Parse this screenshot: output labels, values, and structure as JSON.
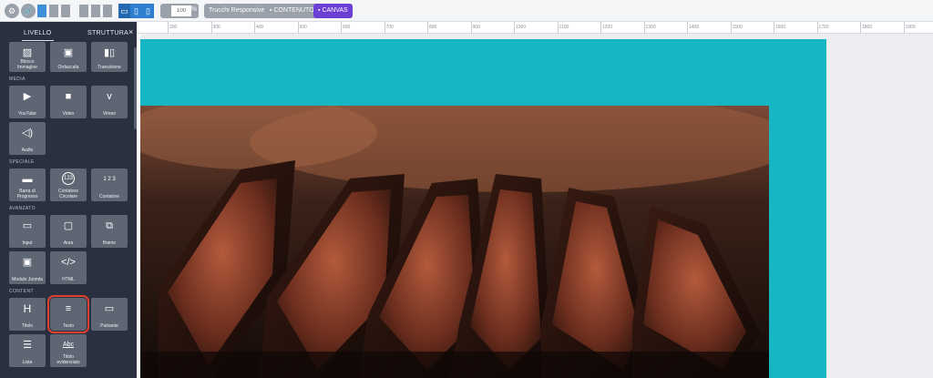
{
  "toolbar": {
    "zoom_value": "100",
    "zoom_unit": "%",
    "responsive_tricks": "Trucchi Responsive",
    "mode_content": "CONTENUTO",
    "mode_canvas": "CANVAS",
    "colors": {
      "grey": "#9aa1ab",
      "blue": "#3d8fd8",
      "purple": "#6b3fd6"
    }
  },
  "sidebar": {
    "tab_layer": "LIVELLO",
    "tab_structure": "STRUTTURA",
    "close_icon": "×",
    "top_row": [
      {
        "icon": "image-block-icon",
        "label": "Blocco Immagine"
      },
      {
        "icon": "image-icon",
        "label": "Ordascafa"
      },
      {
        "icon": "transition-icon",
        "label": "Transizione"
      }
    ],
    "sections": [
      {
        "title": "MEDIA",
        "items": [
          {
            "icon": "youtube-icon",
            "label": "YouTube"
          },
          {
            "icon": "video-camera-icon",
            "label": "Video"
          },
          {
            "icon": "vimeo-icon",
            "label": "Vimeo"
          },
          {
            "icon": "audio-icon",
            "label": "Audio"
          }
        ]
      },
      {
        "title": "SPECIALE",
        "items": [
          {
            "icon": "progress-bar-icon",
            "label": "Barra di Progresso"
          },
          {
            "icon": "circle-counter-icon",
            "label": "Contatore Circolare"
          },
          {
            "icon": "counter-icon",
            "label": "Contatore"
          }
        ]
      },
      {
        "title": "AVANZATO",
        "items": [
          {
            "icon": "input-icon",
            "label": "Input"
          },
          {
            "icon": "textarea-icon",
            "label": "Area"
          },
          {
            "icon": "iframe-icon",
            "label": "Iframe"
          },
          {
            "icon": "joomla-module-icon",
            "label": "Modulo Joomla"
          },
          {
            "icon": "html-code-icon",
            "label": "HTML"
          }
        ]
      },
      {
        "title": "CONTENT",
        "items": [
          {
            "icon": "heading-icon",
            "label": "Titolo"
          },
          {
            "icon": "text-icon",
            "label": "Testo",
            "highlighted": true
          },
          {
            "icon": "button-icon",
            "label": "Pulsante"
          },
          {
            "icon": "list-icon",
            "label": "Lista"
          },
          {
            "icon": "highlighted-title-icon",
            "label": "Titolo evidenziato"
          }
        ]
      }
    ],
    "glyphs": {
      "counter": "1 2 3",
      "circle_counter": "123",
      "heading": "H",
      "html": "</>",
      "highlighted_title": "Abc"
    }
  },
  "ruler": {
    "labels": [
      "200",
      "300",
      "400",
      "500",
      "600",
      "700",
      "800",
      "900",
      "1000",
      "1100",
      "1200",
      "1300",
      "1400",
      "1500",
      "1600",
      "1700",
      "1800",
      "1900"
    ]
  },
  "canvas": {
    "stage_color": "#17b6c3",
    "photo_subject": "sliced grilled steak"
  }
}
